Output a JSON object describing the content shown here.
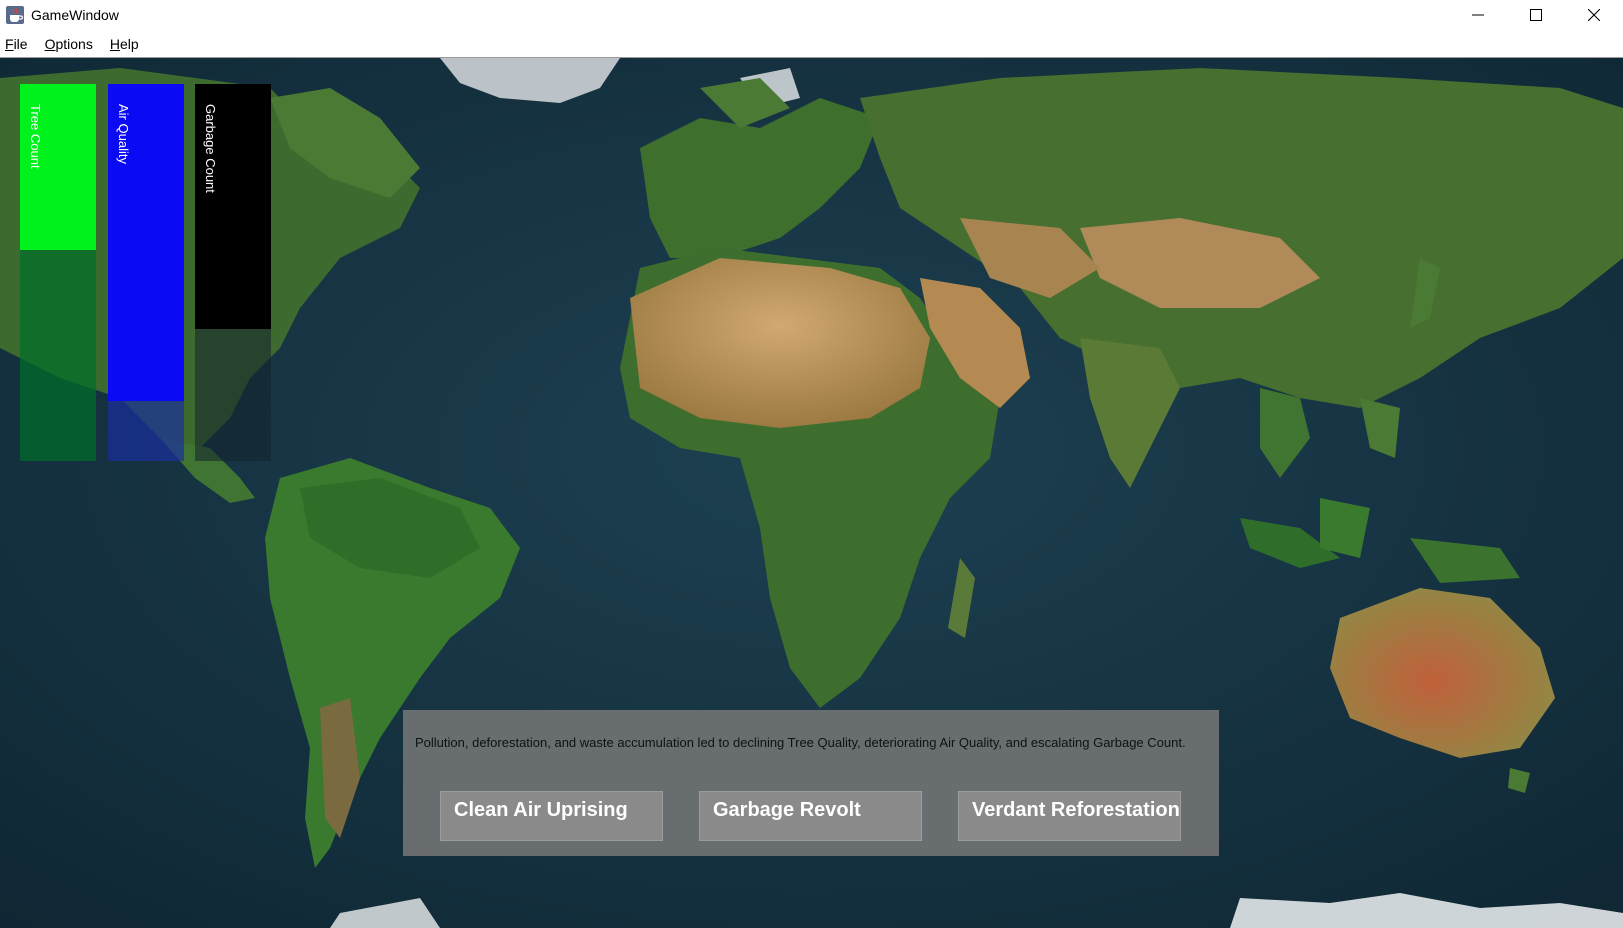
{
  "window": {
    "title": "GameWindow",
    "app_icon": "java-coffee-cup-icon"
  },
  "menu": {
    "items": [
      {
        "mnemonic": "F",
        "rest": "ile"
      },
      {
        "mnemonic": "O",
        "rest": "ptions"
      },
      {
        "mnemonic": "H",
        "rest": "elp"
      }
    ]
  },
  "stats": [
    {
      "label": "Tree Count",
      "level": 0.44,
      "color": "#00f21c"
    },
    {
      "label": "Air Quality",
      "level": 0.84,
      "color": "#0a0af5"
    },
    {
      "label": "Garbage Count",
      "level": 0.65,
      "color": "#000000"
    }
  ],
  "event": {
    "description": "Pollution, deforestation, and waste accumulation led to declining Tree Quality, deteriorating Air Quality, and escalating Garbage Count.",
    "choices": [
      "Clean Air Uprising",
      "Garbage Revolt",
      "Verdant Reforestation"
    ]
  },
  "colors": {
    "ocean": "#163243",
    "land_green": "#2f6a2a",
    "desert": "#c09558",
    "panel": "#7a7a7a"
  }
}
